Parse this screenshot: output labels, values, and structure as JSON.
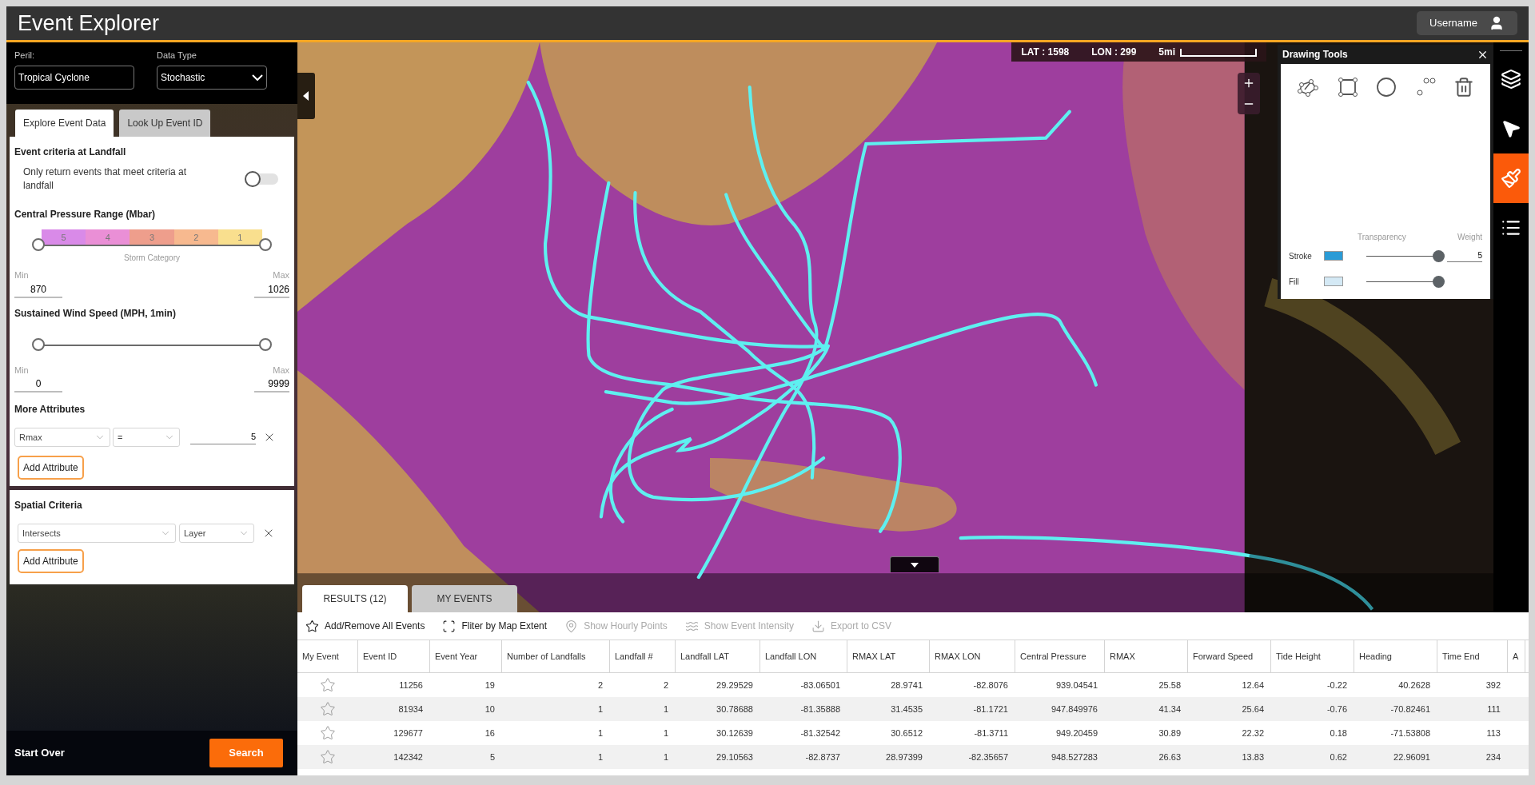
{
  "header": {
    "title": "Event Explorer",
    "user": "Username"
  },
  "filters": {
    "peril": {
      "label": "Peril:",
      "value": "Tropical Cyclone"
    },
    "data_type": {
      "label": "Data Type",
      "value": "Stochastic"
    }
  },
  "side_tabs": [
    {
      "label": "Explore Event Data",
      "selected": true
    },
    {
      "label": "Look Up Event ID",
      "selected": false
    }
  ],
  "landfall": {
    "title": "Event criteria at Landfall",
    "toggle_label": "Only return events that meet criteria at landfall",
    "on": false
  },
  "pressure": {
    "title": "Central Pressure Range (Mbar)",
    "categories": [
      {
        "label": "5",
        "color": "#d98ae8"
      },
      {
        "label": "4",
        "color": "#ea8fd6"
      },
      {
        "label": "3",
        "color": "#ee9e8c"
      },
      {
        "label": "2",
        "color": "#f7b98f"
      },
      {
        "label": "1",
        "color": "#f9df8e"
      }
    ],
    "caption": "Storm Category",
    "thumbs": [
      {
        "level": 0
      },
      {
        "level": 1
      }
    ],
    "min_label": "Min",
    "min": "870",
    "max_label": "Max",
    "max": "1026"
  },
  "wind": {
    "title": "Sustained Wind Speed (MPH, 1min)",
    "thumbs": [
      {
        "level": 0
      },
      {
        "level": 1
      }
    ],
    "min_label": "Min",
    "min": "0",
    "max_label": "Max",
    "max": "9999"
  },
  "more_attributes": {
    "title": "More Attributes",
    "rows": [
      {
        "field": "Rmax",
        "operator": "=",
        "value": "5"
      }
    ],
    "add_button": "Add Attribute"
  },
  "spatial": {
    "title": "Spatial Criteria",
    "rows": [
      {
        "relation": "Intersects",
        "target": "Layer"
      }
    ],
    "add_button": "Add Attribute"
  },
  "footer": {
    "start_over": "Start Over",
    "search": "Search"
  },
  "map_status": {
    "lat_label": "LAT :",
    "lat": "1598",
    "lon_label": "LON :",
    "lon": "299",
    "scale": "5mi"
  },
  "drawing_tools": {
    "title": "Drawing Tools",
    "transparency_label": "Transparency",
    "weight_label": "Weight",
    "rows": [
      {
        "label": "Stroke",
        "color": "#2a9bd6",
        "level": 1,
        "weight": "5"
      },
      {
        "label": "Fill",
        "color": "#d4e9f5",
        "level": 1
      }
    ]
  },
  "toolbar": [
    {
      "kind": "layers",
      "selected": false
    },
    {
      "kind": "pointer",
      "selected": false
    },
    {
      "kind": "brush",
      "selected": true
    },
    {
      "kind": "legend",
      "selected": false
    }
  ],
  "results": {
    "tabs": [
      {
        "label": "RESULTS (12)",
        "selected": true
      },
      {
        "label": "MY EVENTS",
        "selected": false
      }
    ],
    "actions": [
      {
        "kind": "star",
        "label": "Add/Remove All Events",
        "disabled": false
      },
      {
        "kind": "extent",
        "label": "Fliter by Map Extent",
        "disabled": false
      },
      {
        "kind": "pin",
        "label": "Show Hourly Points",
        "disabled": true
      },
      {
        "kind": "intensity",
        "label": "Show Event Intensity",
        "disabled": true
      },
      {
        "kind": "export",
        "label": "Export to CSV",
        "disabled": true
      }
    ],
    "columns": [
      "My Event",
      "Event ID",
      "Event Year",
      "Number of Landfalls",
      "Landfall #",
      "Landfall LAT",
      "Landfall LON",
      "RMAX LAT",
      "RMAX LON",
      "Central Pressure",
      "RMAX",
      "Forward Speed",
      "Tide Height",
      "Heading",
      "Time End",
      "A"
    ],
    "rows": [
      {
        "starred": false,
        "cells": [
          "",
          "11256",
          "19",
          "2",
          "2",
          "29.29529",
          "-83.06501",
          "28.9741",
          "-82.8076",
          "939.04541",
          "25.58",
          "12.64",
          "-0.22",
          "40.2628",
          "392"
        ]
      },
      {
        "starred": false,
        "cells": [
          "",
          "81934",
          "10",
          "1",
          "1",
          "30.78688",
          "-81.35888",
          "31.4535",
          "-81.1721",
          "947.849976",
          "41.34",
          "25.64",
          "-0.76",
          "-70.82461",
          "111"
        ]
      },
      {
        "starred": false,
        "cells": [
          "",
          "129677",
          "16",
          "1",
          "1",
          "30.12639",
          "-81.32542",
          "30.6512",
          "-81.3711",
          "949.20459",
          "30.89",
          "22.32",
          "0.18",
          "-71.53808",
          "113"
        ]
      },
      {
        "starred": false,
        "cells": [
          "",
          "142342",
          "5",
          "1",
          "1",
          "29.10563",
          "-82.8737",
          "28.97399",
          "-82.35657",
          "948.527283",
          "26.63",
          "13.83",
          "0.62",
          "22.96091",
          "234"
        ]
      }
    ]
  }
}
